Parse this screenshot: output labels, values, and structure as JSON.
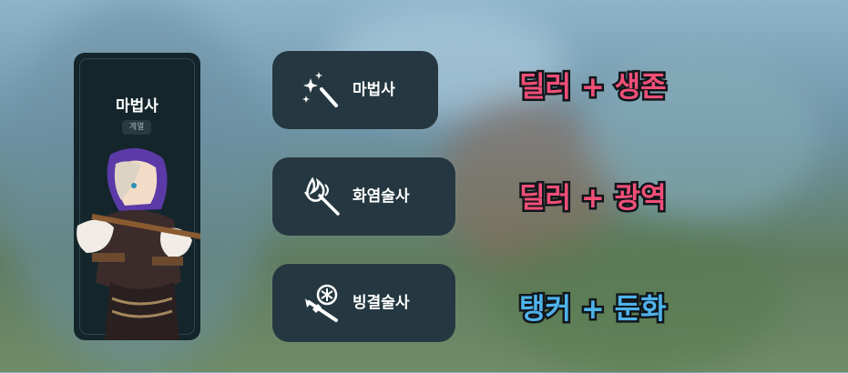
{
  "class_card": {
    "title": "마법사",
    "badge": "계열"
  },
  "skills": [
    {
      "label": "마법사",
      "icon": "magic-wand-icon"
    },
    {
      "label": "화염술사",
      "icon": "fire-staff-icon"
    },
    {
      "label": "빙결술사",
      "icon": "ice-staff-icon"
    }
  ],
  "roles": [
    {
      "text": "딜러 + 생존",
      "color": "#f04f78"
    },
    {
      "text": "딜러 + 광역",
      "color": "#f04f78"
    },
    {
      "text": "탱커 + 둔화",
      "color": "#4fb3ec"
    }
  ]
}
